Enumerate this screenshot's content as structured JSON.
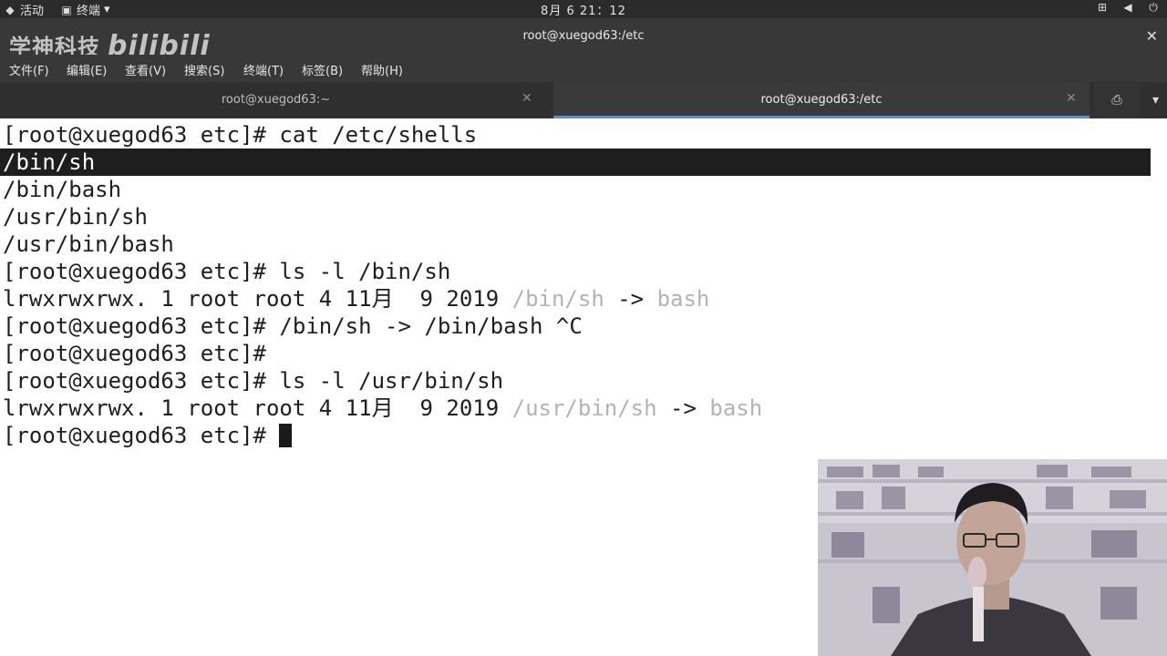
{
  "topbar": {
    "activities": "活动",
    "app": "终端",
    "clock": "8月 6 21：12"
  },
  "window": {
    "watermark_text": "学神科技",
    "watermark_logo": "bilibili",
    "title": "root@xuegod63:/etc"
  },
  "menu": [
    "文件(F)",
    "编辑(E)",
    "查看(V)",
    "搜索(S)",
    "终端(T)",
    "标签(B)",
    "帮助(H)"
  ],
  "tabs": [
    {
      "label": "root@xuegod63:~",
      "active": false
    },
    {
      "label": "root@xuegod63:/etc",
      "active": true
    }
  ],
  "terminal": {
    "lines": [
      "[root@xuegod63 etc]# cat /etc/shells",
      "/bin/sh",
      "/bin/bash",
      "/usr/bin/sh",
      "/usr/bin/bash",
      "[root@xuegod63 etc]# ls -l /bin/sh",
      "lrwxrwxrwx. 1 root root 4 11月  9 2019 ",
      "[root@xuegod63 etc]# /bin/sh -> /bin/bash ^C",
      "[root@xuegod63 etc]#",
      "[root@xuegod63 etc]# ls -l /usr/bin/sh",
      "lrwxrwxrwx. 1 root root 4 11月  9 2019 ",
      "[root@xuegod63 etc]# "
    ],
    "link1_name": "/bin/sh",
    "link1_arrow": " -> ",
    "link1_target": "bash",
    "link2_name": "/usr/bin/sh",
    "link2_arrow": " -> ",
    "link2_target": "bash"
  },
  "colors": {
    "terminal_bg": "#ffffff",
    "terminal_fg": "#1e1e1e",
    "selection_bg": "#1e1e1e",
    "symlink_dim": "#b3b3b3",
    "chrome_bg": "#383838"
  },
  "icons": [
    "app-menu-icon",
    "terminal-icon",
    "network-icon",
    "volume-icon",
    "power-icon",
    "close-icon",
    "new-tab-icon",
    "menu-icon"
  ]
}
